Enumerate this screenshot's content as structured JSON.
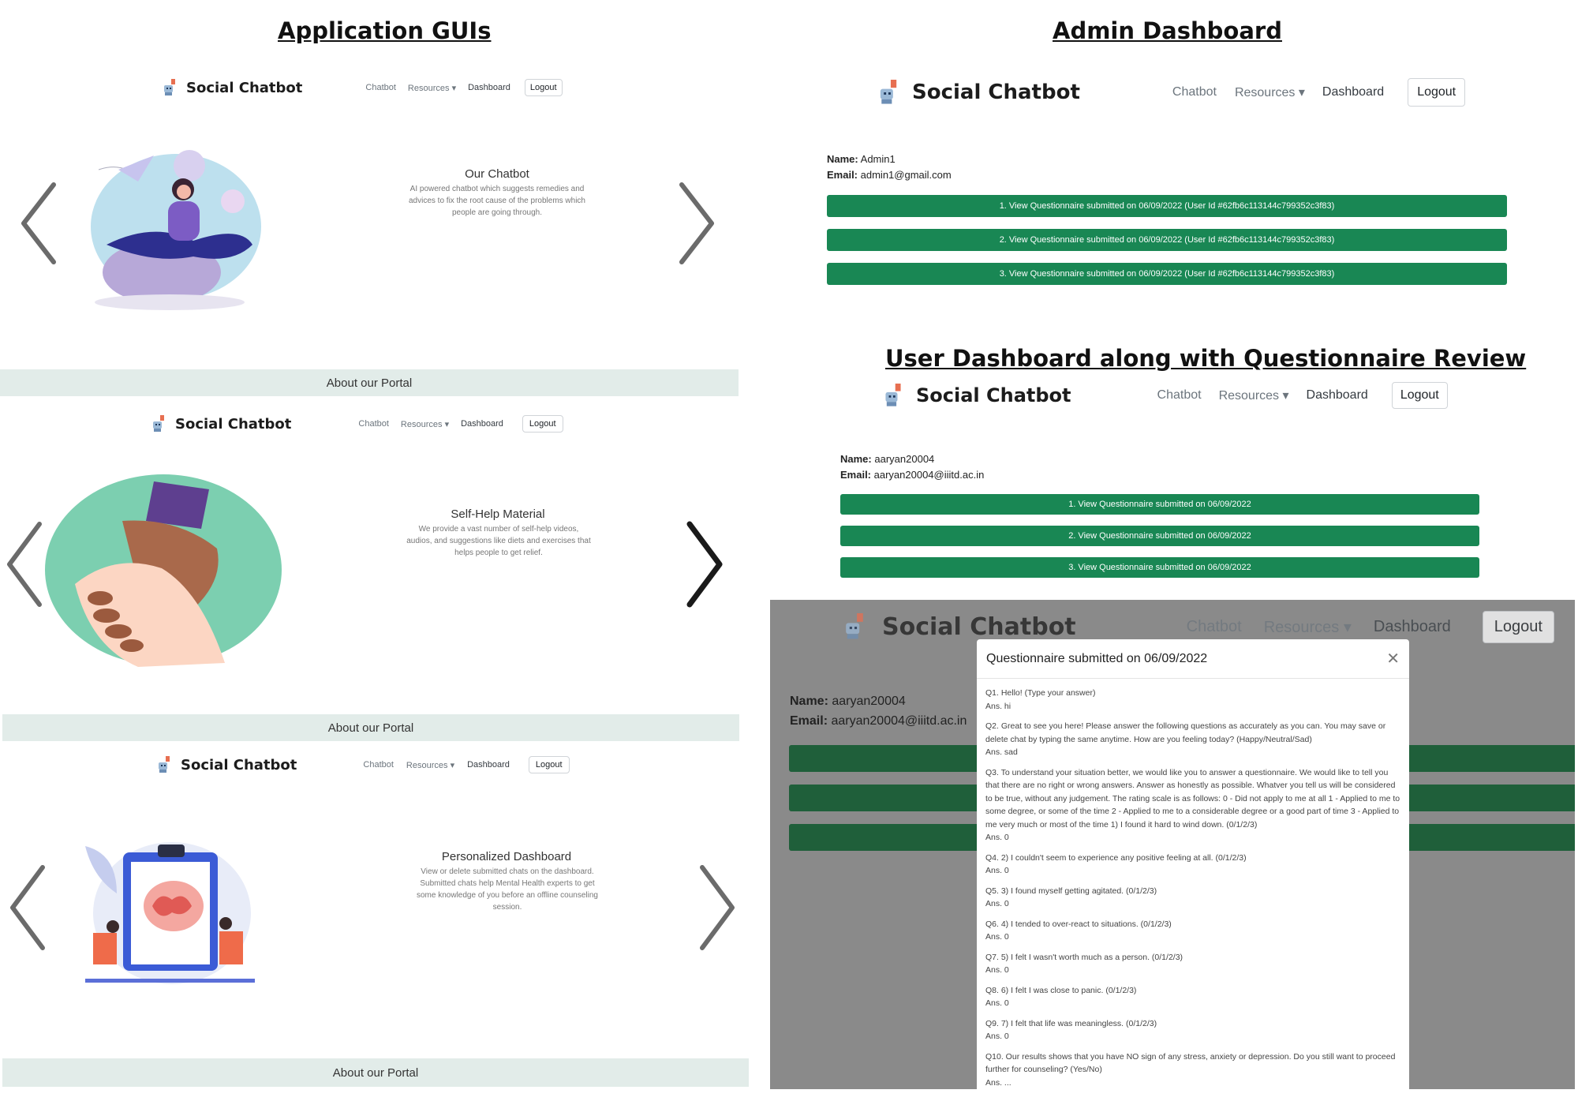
{
  "sections": {
    "app_guis": "Application GUIs",
    "admin_dashboard": "Admin Dashboard",
    "user_dashboard": "User Dashboard along with Questionnaire Review"
  },
  "navbar": {
    "brand": "Social Chatbot",
    "links": [
      "Chatbot",
      "Resources",
      "Dashboard"
    ],
    "logout": "Logout"
  },
  "slides": [
    {
      "title": "Our Chatbot",
      "description": "AI powered chatbot which suggests remedies and advices to fix the root cause of the problems which people are going through.",
      "about": "About our Portal"
    },
    {
      "title": "Self-Help Material",
      "description": "We provide a vast number of self-help videos, audios, and suggestions like diets and exercises that helps people to get relief.",
      "about": "About our Portal"
    },
    {
      "title": "Personalized Dashboard",
      "description": "View or delete submitted chats on the dashboard. Submitted chats help Mental Health experts to get some knowledge of you before an offline counseling session.",
      "about": "About our Portal"
    }
  ],
  "admin": {
    "name_label": "Name:",
    "name": "Admin1",
    "email_label": "Email:",
    "email": "admin1@gmail.com",
    "buttons": [
      "1. View Questionnaire submitted on 06/09/2022 (User Id #62fb6c113144c799352c3f83)",
      "2. View Questionnaire submitted on 06/09/2022 (User Id #62fb6c113144c799352c3f83)",
      "3. View Questionnaire submitted on 06/09/2022 (User Id #62fb6c113144c799352c3f83)"
    ]
  },
  "user": {
    "name_label": "Name:",
    "name": "aaryan20004",
    "email_label": "Email:",
    "email": "aaryan20004@iiitd.ac.in",
    "buttons": [
      "1. View Questionnaire submitted on 06/09/2022",
      "2. View Questionnaire submitted on 06/09/2022",
      "3. View Questionnaire submitted on 06/09/2022"
    ]
  },
  "modal": {
    "title": "Questionnaire submitted on 06/09/2022",
    "close_icon": "close-icon",
    "items": [
      {
        "q": "Q1. Hello! (Type your answer)",
        "a": "Ans. hi"
      },
      {
        "q": "Q2. Great to see you here! Please answer the following questions as accurately as you can. You may save or delete chat by typing the same anytime. How are you feeling today? (Happy/Neutral/Sad)",
        "a": "Ans. sad"
      },
      {
        "q": "Q3. To understand your situation better, we would like you to answer a questionnaire. We would like to tell you that there are no right or wrong answers. Answer as honestly as possible. Whatver you tell us will be considered to be true, without any judgement. The rating scale is as follows: 0 - Did not apply to me at all 1 - Applied to me to some degree, or some of the time 2 - Applied to me to a considerable degree or a good part of time 3 - Applied to me very much or most of the time 1) I found it hard to wind down. (0/1/2/3)",
        "a": "Ans. 0"
      },
      {
        "q": "Q4. 2) I couldn't seem to experience any positive feeling at all. (0/1/2/3)",
        "a": "Ans. 0"
      },
      {
        "q": "Q5. 3) I found myself getting agitated. (0/1/2/3)",
        "a": "Ans. 0"
      },
      {
        "q": "Q6. 4) I tended to over-react to situations. (0/1/2/3)",
        "a": "Ans. 0"
      },
      {
        "q": "Q7. 5) I felt I wasn't worth much as a person. (0/1/2/3)",
        "a": "Ans. 0"
      },
      {
        "q": "Q8. 6) I felt I was close to panic. (0/1/2/3)",
        "a": "Ans. 0"
      },
      {
        "q": "Q9. 7) I felt that life was meaningless. (0/1/2/3)",
        "a": "Ans. 0"
      },
      {
        "q": "Q10. Our results shows that you have NO sign of any stress, anxiety or depression. Do you still want to proceed further for counseling? (Yes/No)",
        "a": "Ans. ..."
      }
    ]
  },
  "colors": {
    "accent_green": "#198754",
    "about_bar": "#e2ece9",
    "overlay": "#8a8a8a"
  }
}
